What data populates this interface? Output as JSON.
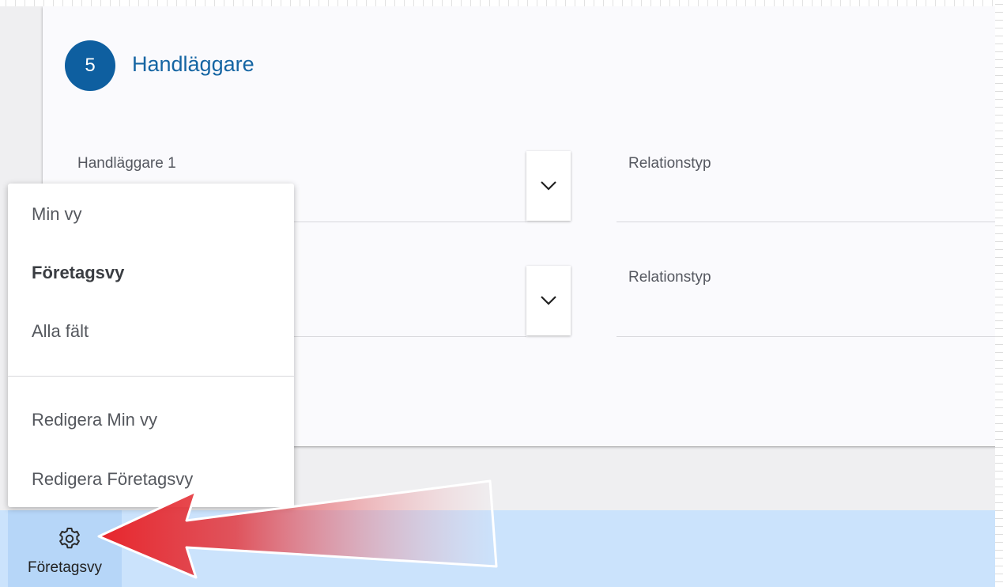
{
  "section": {
    "step_number": "5",
    "title": "Handläggare"
  },
  "fields": {
    "handlaggare_1_label": "Handläggare 1",
    "relationstyp_1_label": "Relationstyp",
    "relationstyp_2_label": "Relationstyp"
  },
  "view_menu": {
    "items": [
      {
        "label": "Min vy",
        "selected": false
      },
      {
        "label": "Företagsvy",
        "selected": true
      },
      {
        "label": "Alla fält",
        "selected": false
      }
    ],
    "actions": [
      {
        "label": "Redigera Min vy"
      },
      {
        "label": "Redigera Företagsvy"
      }
    ]
  },
  "toolbar": {
    "view_button_label": "Företagsvy",
    "view_button_icon": "gear-icon"
  },
  "annotation": {
    "arrow_color": "#e8242a"
  },
  "colors": {
    "accent": "#0e5fa0",
    "bottom_bar": "#cbe3fc"
  }
}
